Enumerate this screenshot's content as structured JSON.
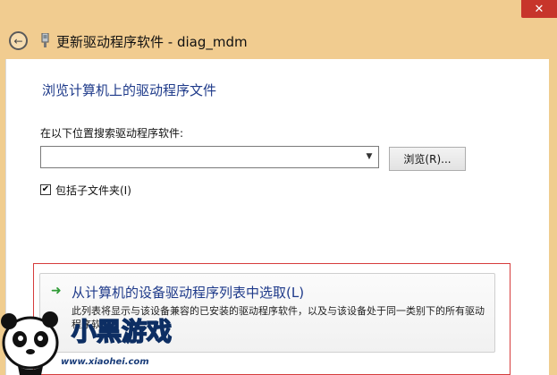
{
  "window": {
    "title": "更新驱动程序软件 - diag_mdm",
    "close_glyph": "✕",
    "back_glyph": "←"
  },
  "page": {
    "heading": "浏览计算机上的驱动程序文件",
    "search_label": "在以下位置搜索驱动程序软件:",
    "path_value": "",
    "browse_label": "浏览(R)...",
    "include_subfolders_label": "包括子文件夹(I)",
    "include_subfolders_checked": true,
    "checkbox_glyph": "✔"
  },
  "pick_option": {
    "title": "从计算机的设备驱动程序列表中选取(L)",
    "description": "此列表将显示与该设备兼容的已安装的驱动程序软件，以及与该设备处于同一类别下的所有驱动程序软件。",
    "arrow_glyph": "➜"
  },
  "watermark": {
    "logo_text": "小黑游戏",
    "url": "www.xiaohei.com"
  },
  "colors": {
    "frame": "#f1cc90",
    "heading": "#1e3a8a",
    "close": "#c7352b",
    "highlight": "#d63c3c"
  }
}
